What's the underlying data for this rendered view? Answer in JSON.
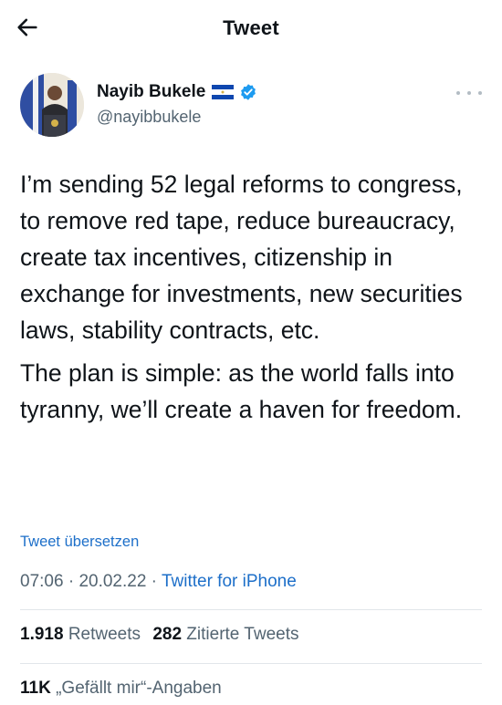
{
  "header": {
    "title": "Tweet",
    "back_icon": "arrow-left-icon"
  },
  "author": {
    "name": "Nayib Bukele",
    "handle": "@nayibbukele",
    "flag": "el-salvador-flag-icon",
    "verified": true,
    "verified_color": "#1d9bf0"
  },
  "tweet": {
    "paragraphs": [
      "I’m sending 52 legal reforms to congress, to remove red tape, reduce bureaucracy, create tax incentives, citizenship in exchange for investments, new securities laws, stability contracts, etc.",
      "The plan is simple: as the world falls into tyranny, we’ll create a haven for freedom."
    ],
    "translate_label": "Tweet übersetzen",
    "time": "07:06",
    "date": "20.02.22",
    "separator": " · ",
    "source": "Twitter for iPhone"
  },
  "stats": {
    "retweets_count": "1.918",
    "retweets_label": "Retweets",
    "quotes_count": "282",
    "quotes_label": "Zitierte Tweets",
    "likes_count": "11K",
    "likes_label": "„Gefällt mir“-Angaben"
  },
  "colors": {
    "link": "#1d6fc9",
    "secondary_text": "#536471",
    "primary_text": "#0f1419"
  }
}
